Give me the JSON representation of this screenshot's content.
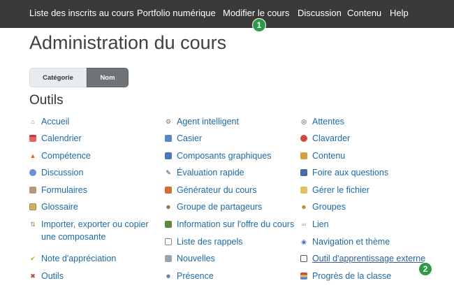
{
  "nav": {
    "items": [
      "Liste des inscrits au cours",
      "Portfolio numérique",
      "Modifier le cours",
      "Discussion",
      "Contenu",
      "Help"
    ]
  },
  "page": {
    "title": "Administration du cours",
    "toggle_category": "Catégorie",
    "toggle_name": "Nom",
    "section_title": "Outils"
  },
  "tools": {
    "col1": [
      "Accueil",
      "Calendrier",
      "Compétence",
      "Discussion",
      "Formulaires",
      "Glossaire",
      "Importer, exporter ou copier une composante",
      "Note d'appréciation",
      "Outils"
    ],
    "col2": [
      "Agent intelligent",
      "Casier",
      "Composants graphiques",
      "Évaluation rapide",
      "Générateur du cours",
      "Groupe de partageurs",
      "Information sur l'offre du cours",
      "Liste des rappels",
      "Nouvelles",
      "Présence"
    ],
    "col3": [
      "Attentes",
      "Clavarder",
      "Contenu",
      "Foire aux questions",
      "Gérer le fichier",
      "Groupes",
      "Lien",
      "Navigation et thème",
      "Outil d'apprentissage externe",
      "Progrès de la classe"
    ]
  },
  "badges": [
    "1",
    "2"
  ],
  "colors": {
    "nav_bg": "#3a3a3a",
    "link": "#1d6aa5",
    "badge": "#2e9a48"
  }
}
